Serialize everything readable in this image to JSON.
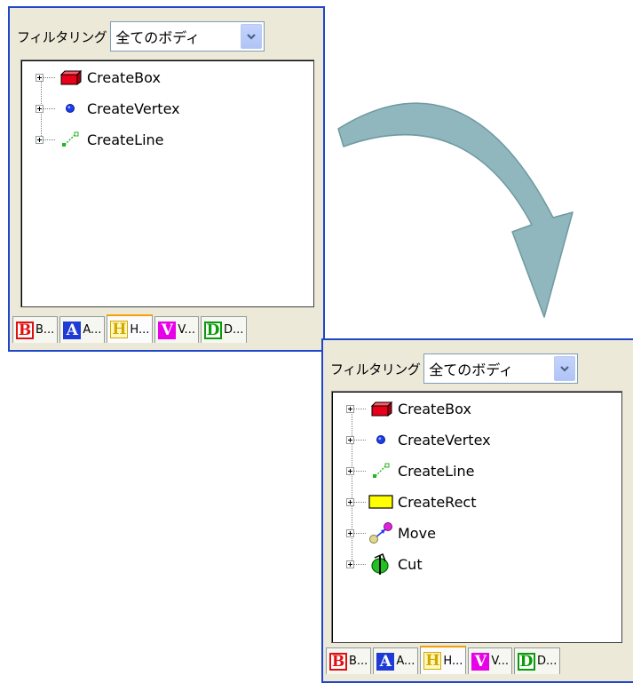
{
  "filter_label": "フィルタリング",
  "filter_value": "全てのボディ",
  "before": {
    "nodes": [
      {
        "label": "CreateBox",
        "icon": "box-icon"
      },
      {
        "label": "CreateVertex",
        "icon": "vertex-icon"
      },
      {
        "label": "CreateLine",
        "icon": "line-icon"
      }
    ]
  },
  "after": {
    "nodes": [
      {
        "label": "CreateBox",
        "icon": "box-icon"
      },
      {
        "label": "CreateVertex",
        "icon": "vertex-icon"
      },
      {
        "label": "CreateLine",
        "icon": "line-icon"
      },
      {
        "label": "CreateRect",
        "icon": "rect-icon"
      },
      {
        "label": "Move",
        "icon": "move-icon"
      },
      {
        "label": "Cut",
        "icon": "cut-icon"
      }
    ]
  },
  "tabs": [
    {
      "letter": "B",
      "label": "B...",
      "active": false
    },
    {
      "letter": "A",
      "label": "A...",
      "active": false
    },
    {
      "letter": "H",
      "label": "H...",
      "active": true
    },
    {
      "letter": "V",
      "label": "V...",
      "active": false
    },
    {
      "letter": "D",
      "label": "D...",
      "active": false
    }
  ],
  "colors": {
    "panel_border": "#1f47c8",
    "panel_bg": "#ece9d8",
    "arrow_fill": "#8fb7bd",
    "tab_active_accent": "#f4a100"
  }
}
